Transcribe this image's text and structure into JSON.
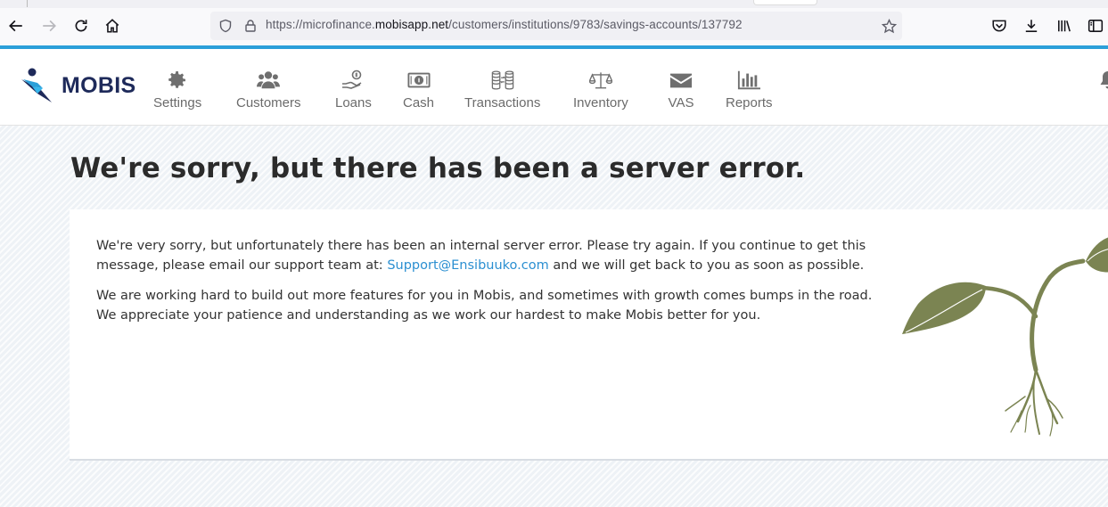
{
  "browser": {
    "url_prefix": "https://microfinance.",
    "url_host": "mobisapp.net",
    "url_path": "/customers/institutions/9783/savings-accounts/137792",
    "icons": [
      "back-icon",
      "forward-icon",
      "reload-icon",
      "home-icon",
      "shield-icon",
      "lock-icon",
      "star-icon",
      "pocket-icon",
      "download-icon",
      "library-icon",
      "sidebar-icon"
    ]
  },
  "app": {
    "logo_text": "MOBIS",
    "nav": [
      {
        "label": "Settings",
        "icon": "gear-icon"
      },
      {
        "label": "Customers",
        "icon": "users-icon"
      },
      {
        "label": "Loans",
        "icon": "loan-hand-icon"
      },
      {
        "label": "Cash",
        "icon": "cash-icon"
      },
      {
        "label": "Transactions",
        "icon": "coins-exchange-icon"
      },
      {
        "label": "Inventory",
        "icon": "scale-icon"
      },
      {
        "label": "VAS",
        "icon": "envelope-icon"
      },
      {
        "label": "Reports",
        "icon": "bar-chart-icon"
      }
    ]
  },
  "error": {
    "title": "We're sorry, but there has been a server error.",
    "p1_before": "We're very sorry, but unfortunately there has been an internal server error. Please try again. If you continue to get this message, please email our support team at: ",
    "support_email": "Support@Ensibuuko.com",
    "p1_after": " and we will get back to you as soon as possible.",
    "p2": "We are working hard to build out more features for you in Mobis, and sometimes with growth comes bumps in the road. We appreciate your patience and understanding as we work our hardest to make Mobis better for you."
  },
  "colors": {
    "accent_line": "#2b9fd9",
    "logo_navy": "#1e2a5a",
    "link": "#2b8fd1",
    "plant": "#7b8452"
  }
}
